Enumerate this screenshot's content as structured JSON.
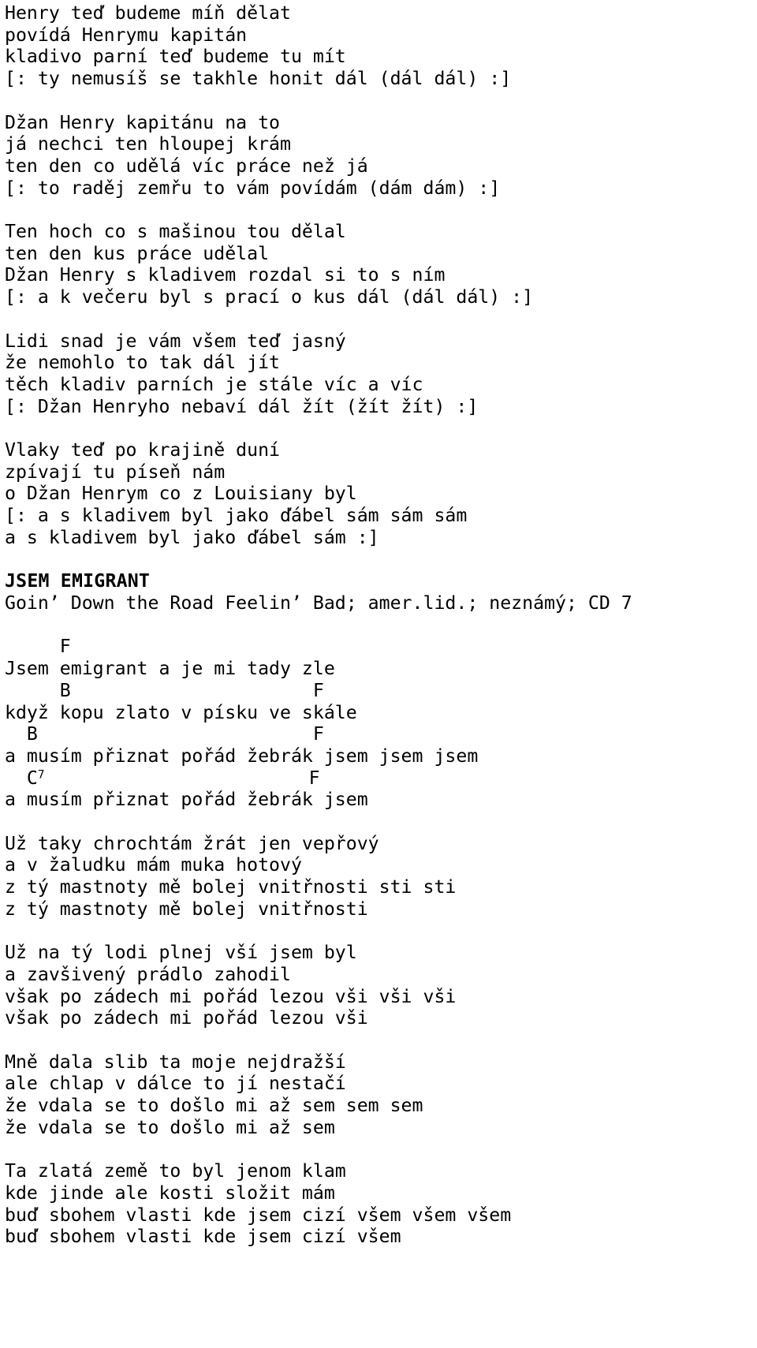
{
  "page": {
    "kind": "songbook-lyrics-page",
    "font_color": "#000000",
    "background_color": "#ffffff"
  },
  "song_previous": {
    "stanzas": [
      {
        "lines": [
          "Henry teď budeme míň dělat",
          "povídá Henrymu kapitán",
          "kladivo parní teď budeme tu mít",
          "[: ty nemusíš se takhle honit dál (dál dál) :]"
        ]
      },
      {
        "lines": [
          "Džan Henry kapitánu na to",
          "já nechci ten hloupej krám",
          "ten den co udělá víc práce než já",
          "[: to raděj zemřu to vám povídám (dám dám) :]"
        ]
      },
      {
        "lines": [
          "Ten hoch co s mašinou tou dělal",
          "ten den kus práce udělal",
          "Džan Henry s kladivem rozdal si to s ním",
          "[: a k večeru byl s prací o kus dál (dál dál) :]"
        ]
      },
      {
        "lines": [
          "Lidi snad je vám všem teď jasný",
          "že nemohlo to tak dál jít",
          "těch kladiv parních je stále víc a víc",
          "[: Džan Henryho nebaví dál žít (žít žít) :]"
        ]
      },
      {
        "lines": [
          "Vlaky teď po krajině duní",
          "zpívají tu píseň nám",
          "o Džan Henrym co z Louisiany byl",
          "[: a s kladivem byl jako ďábel sám sám sám",
          "a s kladivem byl jako ďábel sám :]"
        ]
      }
    ]
  },
  "song": {
    "title": "JSEM EMIGRANT",
    "credits": "Goin’ Down the Road Feelin’ Bad; amer.lid.; neznámý; CD 7",
    "chorus": {
      "rows": [
        {
          "type": "chord",
          "text": "     F"
        },
        {
          "type": "lyric",
          "text": "Jsem emigrant a je mi tady zle"
        },
        {
          "type": "chord",
          "text": "     B                      F"
        },
        {
          "type": "lyric",
          "text": "když kopu zlato v písku ve skále"
        },
        {
          "type": "chord",
          "text": "  B                         F"
        },
        {
          "type": "lyric",
          "text": "a musím přiznat pořád žebrák jsem jsem jsem"
        },
        {
          "type": "chord-sup",
          "pre": "  C",
          "sup": "7",
          "post": "                        F"
        },
        {
          "type": "lyric",
          "text": "a musím přiznat pořád žebrák jsem"
        }
      ],
      "chords": [
        "F",
        "B",
        "F",
        "B",
        "F",
        "C7",
        "F"
      ]
    },
    "verses": [
      {
        "lines": [
          "Už taky chrochtám žrát jen vepřový",
          "a v žaludku mám muka hotový",
          "z tý mastnoty mě bolej vnitřnosti sti sti",
          "z tý mastnoty mě bolej vnitřnosti"
        ]
      },
      {
        "lines": [
          "Už na tý lodi plnej vší jsem byl",
          "a zavšivený prádlo zahodil",
          "však po zádech mi pořád lezou vši vši vši",
          "však po zádech mi pořád lezou vši"
        ]
      },
      {
        "lines": [
          "Mně dala slib ta moje nejdražší",
          "ale chlap v dálce to jí nestačí",
          "že vdala se to došlo mi až sem sem sem",
          "že vdala se to došlo mi až sem"
        ]
      },
      {
        "lines": [
          "Ta zlatá země to byl jenom klam",
          "kde jinde ale kosti složit mám",
          "buď sbohem vlasti kde jsem cizí všem všem všem",
          "buď sbohem vlasti kde jsem cizí všem"
        ]
      }
    ]
  }
}
